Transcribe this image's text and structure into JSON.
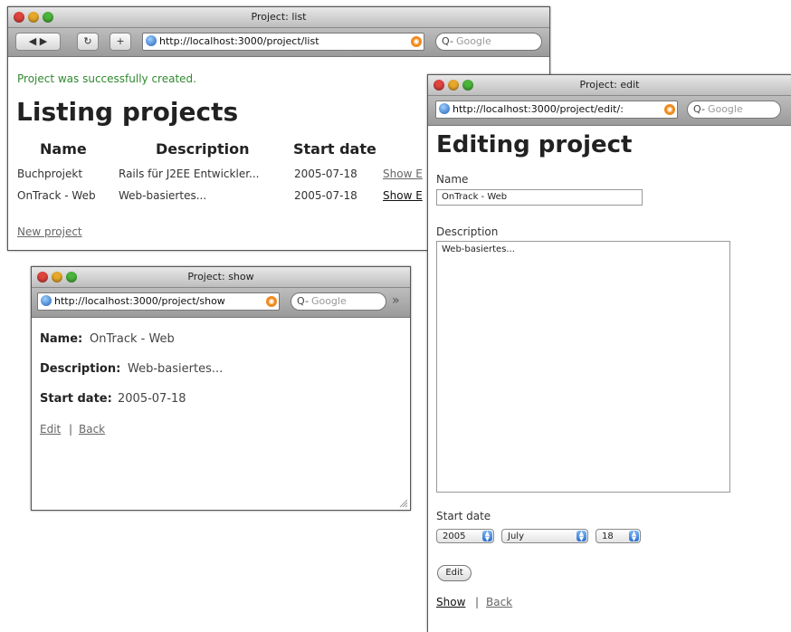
{
  "list_window": {
    "title": "Project: list",
    "url": "http://localhost:3000/project/list",
    "search_placeholder": "Google",
    "flash": "Project was successfully created.",
    "heading": "Listing projects",
    "columns": [
      "Name",
      "Description",
      "Start date"
    ],
    "rows": [
      {
        "name": "Buchprojekt",
        "description": "Rails für J2EE Entwickler...",
        "start": "2005-07-18",
        "action": "Show E"
      },
      {
        "name": "OnTrack - Web",
        "description": "Web-basiertes...",
        "start": "2005-07-18",
        "action": "Show E"
      }
    ],
    "new_link": "New project"
  },
  "show_window": {
    "title": "Project: show",
    "url": "http://localhost:3000/project/show",
    "search_placeholder": "Google",
    "name_label": "Name:",
    "name_value": "OnTrack - Web",
    "desc_label": "Description:",
    "desc_value": "Web-basiertes...",
    "start_label": "Start date:",
    "start_value": "2005-07-18",
    "edit_link": "Edit",
    "separator": "|",
    "back_link": "Back"
  },
  "edit_window": {
    "title": "Project: edit",
    "url": "http://localhost:3000/project/edit/:",
    "search_placeholder": "Google",
    "heading": "Editing project",
    "name_label": "Name",
    "name_value": "OnTrack - Web",
    "desc_label": "Description",
    "desc_value": "Web-basiertes...",
    "start_label": "Start date",
    "year": "2005",
    "month": "July",
    "day": "18",
    "submit": "Edit",
    "show_link": "Show",
    "separator": "|",
    "back_link": "Back"
  },
  "icons": {
    "globe": "globe-icon",
    "rss": "rss-icon",
    "search": "search-icon",
    "chevrons": "»"
  }
}
